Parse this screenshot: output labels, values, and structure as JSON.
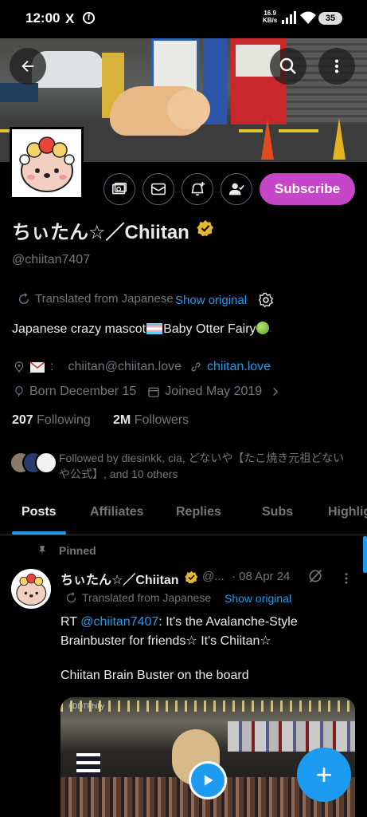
{
  "status_bar": {
    "time": "12:00",
    "x_icon": "X",
    "fb_icon": "f",
    "net_speed_value": "16.9",
    "net_speed_unit": "KB/s",
    "battery": "35"
  },
  "profile": {
    "display_name": "ちぃたん☆／Chiitan",
    "handle": "@chiitan7407",
    "subscribe_label": "Subscribe",
    "translated_label": "Translated from Japanese",
    "show_original_label": "Show original",
    "bio_text_1": "Japanese crazy mascot",
    "bio_text_2": "Baby Otter Fairy",
    "email_sep": ":",
    "email": "chiitan@chiitan.love",
    "website": "chiitan.love",
    "born": "Born December 15",
    "joined": "Joined May 2019",
    "following_count": "207",
    "following_label": "Following",
    "followers_count": "2M",
    "followers_label": "Followers",
    "followed_by": "Followed by diesinkk, cia, どないや【たこ焼き元祖どないや公式】, and 10 others"
  },
  "tabs": [
    {
      "label": "Posts",
      "active": true
    },
    {
      "label": "Affiliates",
      "active": false
    },
    {
      "label": "Replies",
      "active": false
    },
    {
      "label": "Subs",
      "active": false
    },
    {
      "label": "Highlig",
      "active": false
    }
  ],
  "pinned_post": {
    "pinned_label": "Pinned",
    "author_name": "ちぃたん☆／Chiitan",
    "author_handle": "@...",
    "date": "· 08 Apr 24",
    "translated_label": "Translated from Japanese",
    "show_original_label": "Show original",
    "text_prefix": "RT ",
    "mention": "@chiitan7407",
    "text_suffix": ": It's the Avalanche-Style Brainbuster for friends☆ It's Chiitan☆",
    "text_line2": "Chiitan Brain Buster on the board",
    "media_label": "#DDTPhilly"
  },
  "fab_label": "+",
  "colors": {
    "accent": "#1d9bf0",
    "subscribe": "#c646c8",
    "verified": "#e8b82c",
    "muted": "#71767b",
    "background": "#000000"
  },
  "icons": {
    "back": "back-arrow-icon",
    "search": "search-icon",
    "more": "more-vertical-icon",
    "payments": "payments-icon",
    "message": "mail-icon",
    "notify": "bell-plus-icon",
    "following": "person-check-icon",
    "translate": "translate-icon",
    "settings": "gear-icon",
    "location": "location-pin-icon",
    "link": "link-icon",
    "birthday": "balloon-icon",
    "calendar": "calendar-icon",
    "pin": "pin-icon",
    "grok": "grok-icon",
    "post_more": "more-vertical-icon",
    "play": "play-icon",
    "compose": "plus-icon"
  }
}
